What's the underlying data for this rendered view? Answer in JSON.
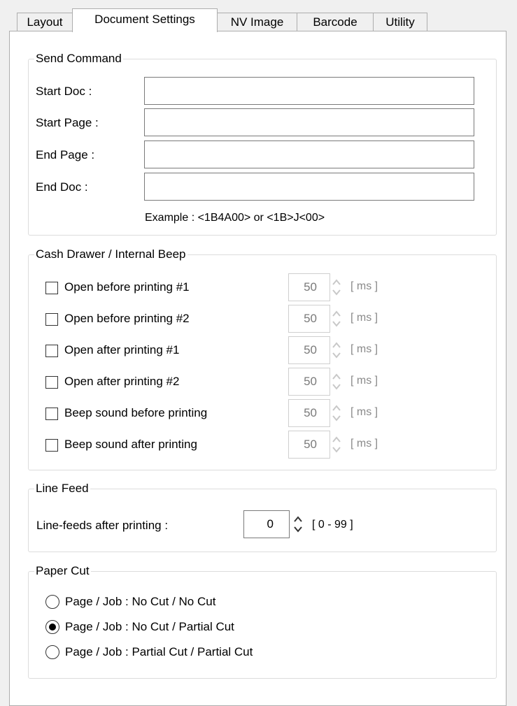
{
  "tabs": [
    {
      "label": "Layout"
    },
    {
      "label": "Document Settings",
      "active": true
    },
    {
      "label": "NV Image"
    },
    {
      "label": "Barcode"
    },
    {
      "label": "Utility"
    }
  ],
  "send_command": {
    "title": "Send Command",
    "fields": [
      {
        "label": "Start Doc :",
        "value": ""
      },
      {
        "label": "Start Page :",
        "value": ""
      },
      {
        "label": "End Page :",
        "value": ""
      },
      {
        "label": "End Doc :",
        "value": ""
      }
    ],
    "example": "Example : <1B4A00> or <1B>J<00>"
  },
  "cash_drawer": {
    "title": "Cash Drawer / Internal Beep",
    "items": [
      {
        "label": "Open before printing #1",
        "checked": false,
        "value": "50",
        "unit": "[ ms ]"
      },
      {
        "label": "Open before printing #2",
        "checked": false,
        "value": "50",
        "unit": "[ ms ]"
      },
      {
        "label": "Open after printing #1",
        "checked": false,
        "value": "50",
        "unit": "[ ms ]"
      },
      {
        "label": "Open after printing #2",
        "checked": false,
        "value": "50",
        "unit": "[ ms ]"
      },
      {
        "label": "Beep sound before printing",
        "checked": false,
        "value": "50",
        "unit": "[ ms ]"
      },
      {
        "label": "Beep sound after printing",
        "checked": false,
        "value": "50",
        "unit": "[ ms ]"
      }
    ]
  },
  "line_feed": {
    "title": "Line Feed",
    "label": "Line-feeds after printing :",
    "value": "0",
    "range": "[ 0 - 99 ]"
  },
  "paper_cut": {
    "title": "Paper Cut",
    "options": [
      {
        "label": "Page / Job : No Cut / No Cut",
        "selected": false
      },
      {
        "label": "Page / Job : No Cut / Partial Cut",
        "selected": true
      },
      {
        "label": "Page / Job : Partial Cut / Partial Cut",
        "selected": false
      }
    ]
  },
  "colors": {
    "border": "#adadad",
    "group_border": "#dcdcdc",
    "disabled_text": "#8a8a8a"
  }
}
